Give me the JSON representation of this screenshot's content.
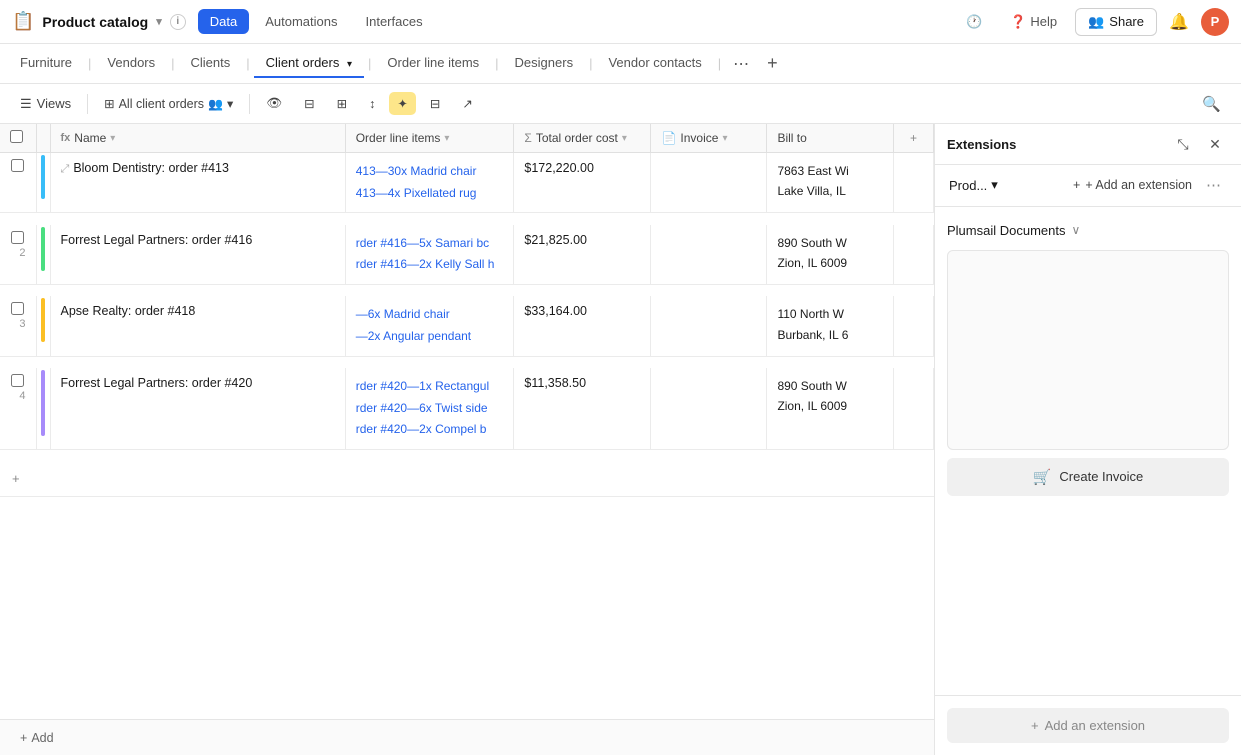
{
  "app": {
    "logo_icon": "📋",
    "title": "Product catalog",
    "chevron": "▾",
    "info_icon": "i"
  },
  "top_nav": {
    "items": [
      {
        "id": "data",
        "label": "Data",
        "active": true
      },
      {
        "id": "automations",
        "label": "Automations",
        "active": false
      },
      {
        "id": "interfaces",
        "label": "Interfaces",
        "active": false
      }
    ],
    "history_icon": "🕐",
    "help_label": "Help",
    "share_label": "Share",
    "share_icon": "👥",
    "avatar_label": "P"
  },
  "tabs": [
    {
      "id": "furniture",
      "label": "Furniture",
      "active": false
    },
    {
      "id": "vendors",
      "label": "Vendors",
      "active": false
    },
    {
      "id": "clients",
      "label": "Clients",
      "active": false
    },
    {
      "id": "client_orders",
      "label": "Client orders",
      "active": true,
      "has_chevron": true
    },
    {
      "id": "order_line_items",
      "label": "Order line items",
      "active": false
    },
    {
      "id": "designers",
      "label": "Designers",
      "active": false
    },
    {
      "id": "vendor_contacts",
      "label": "Vendor contacts",
      "active": false
    }
  ],
  "toolbar": {
    "views_label": "Views",
    "views_icon": "☰",
    "grid_icon": "⊞",
    "view_name": "All client orders",
    "view_chevron": "▾",
    "hide_btn": "🚫",
    "filter_icon": "⊟",
    "group_icon": "⊟",
    "sort_icon": "↕",
    "highlight_icon": "✦",
    "row_height_icon": "⊟",
    "share_view_icon": "↗"
  },
  "columns": [
    {
      "id": "name",
      "label": "Name",
      "icon": "fx"
    },
    {
      "id": "order_lines",
      "label": "Order line items",
      "icon": ""
    },
    {
      "id": "total",
      "label": "Total order cost",
      "icon": "Σ"
    },
    {
      "id": "invoice",
      "label": "Invoice",
      "icon": "📄"
    },
    {
      "id": "billto",
      "label": "Bill to",
      "icon": ""
    }
  ],
  "rows": [
    {
      "num": "",
      "color": "#38bdf8",
      "name": "Bloom Dentistry: order #413",
      "order_lines": [
        "413—30x Madrid chair",
        "413—4x Pixellated rug"
      ],
      "total": "$172,220.00",
      "invoice": "",
      "bill_to_line1": "7863 East Wi",
      "bill_to_line2": "Lake Villa, IL"
    },
    {
      "num": "2",
      "color": "#4ade80",
      "name": "Forrest Legal Partners: order #416",
      "order_lines": [
        "rder #416—5x Samari bc",
        "rder #416—2x Kelly Sall h"
      ],
      "total": "$21,825.00",
      "invoice": "",
      "bill_to_line1": "890 South W",
      "bill_to_line2": "Zion, IL 6009"
    },
    {
      "num": "3",
      "color": "#fbbf24",
      "name": "Apse Realty: order #418",
      "order_lines": [
        "—6x Madrid chair",
        "—2x Angular pendant"
      ],
      "total": "$33,164.00",
      "invoice": "",
      "bill_to_line1": "110 North W",
      "bill_to_line2": "Burbank, IL 6"
    },
    {
      "num": "4",
      "color": "#a78bfa",
      "name": "Forrest Legal Partners: order #420",
      "order_lines": [
        "rder #420—1x Rectangul",
        "rder #420—6x Twist side",
        "rder #420—2x Compel b"
      ],
      "total": "$11,358.50",
      "invoice": "",
      "bill_to_line1": "890 South W",
      "bill_to_line2": "Zion, IL 6009"
    }
  ],
  "add_row_label": "+ Add",
  "right_panel": {
    "extensions_label": "Extensions",
    "expand_icon": "⤡",
    "close_icon": "✕",
    "ext_title": "Prod...",
    "ext_chevron": "▾",
    "add_ext_label": "+ Add an extension",
    "more_icon": "⋯",
    "plumsail_label": "Plumsail Documents",
    "plumsail_chevron": "∨",
    "create_invoice_icon": "🛒",
    "create_invoice_label": "Create Invoice",
    "add_extension_icon": "+",
    "add_extension_label": "Add an extension"
  },
  "bottom": {
    "add_icon": "+",
    "add_label": "Add"
  }
}
